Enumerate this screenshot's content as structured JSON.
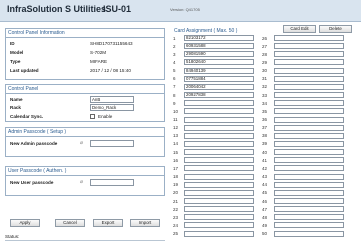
{
  "header": {
    "title": "InfraSolution S Utilities",
    "unit": "ISU-01",
    "version": "Version: Q41705"
  },
  "control_panel_info": {
    "title": "Control Panel Information",
    "id_label": "ID",
    "id_value": "SH8D170731155643",
    "model_label": "Model",
    "model_value": "S-702M",
    "type_label": "Type",
    "type_value": "MIFARE",
    "updated_label": "Last updated",
    "updated_value": "2017 / 12 / 08 15:40"
  },
  "control_panel": {
    "title": "Control Panel",
    "name_label": "Name",
    "name_value": "AnB",
    "rack_label": "Rack",
    "rack_value": "Demo_Rack",
    "sync_label": "Calendar Sync.",
    "enable_label": "Enable"
  },
  "admin_passcode": {
    "title": "Admin Passcode ( Setup )",
    "new_label": "New Admin passcode",
    "value": ""
  },
  "user_passcode": {
    "title": "User Passcode ( Authen. )",
    "new_label": "New User passcode",
    "value": ""
  },
  "bottom_buttons": {
    "apply": "Apply",
    "cancel": "Cancel",
    "export": "Export",
    "import": "Import"
  },
  "status": {
    "label": "Status:"
  },
  "cards": {
    "title": "Card Assignment ( Max. 50 )",
    "edit_label": "Card Edit",
    "delete_label": "Delete",
    "left": [
      {
        "n": "1",
        "v": "82103172"
      },
      {
        "n": "2",
        "v": "60931588"
      },
      {
        "n": "3",
        "v": "29081590"
      },
      {
        "n": "4",
        "v": "51802640"
      },
      {
        "n": "5",
        "v": "84940139"
      },
      {
        "n": "6",
        "v": "07751884"
      },
      {
        "n": "7",
        "v": "20064042"
      },
      {
        "n": "8",
        "v": "20927838"
      },
      {
        "n": "9",
        "v": ""
      },
      {
        "n": "10",
        "v": ""
      },
      {
        "n": "11",
        "v": ""
      },
      {
        "n": "12",
        "v": ""
      },
      {
        "n": "13",
        "v": ""
      },
      {
        "n": "14",
        "v": ""
      },
      {
        "n": "15",
        "v": ""
      },
      {
        "n": "16",
        "v": ""
      },
      {
        "n": "17",
        "v": ""
      },
      {
        "n": "18",
        "v": ""
      },
      {
        "n": "19",
        "v": ""
      },
      {
        "n": "20",
        "v": ""
      },
      {
        "n": "21",
        "v": ""
      },
      {
        "n": "22",
        "v": ""
      },
      {
        "n": "23",
        "v": ""
      },
      {
        "n": "24",
        "v": ""
      },
      {
        "n": "25",
        "v": ""
      }
    ],
    "right": [
      {
        "n": "26",
        "v": ""
      },
      {
        "n": "27",
        "v": ""
      },
      {
        "n": "28",
        "v": ""
      },
      {
        "n": "29",
        "v": ""
      },
      {
        "n": "30",
        "v": ""
      },
      {
        "n": "31",
        "v": ""
      },
      {
        "n": "32",
        "v": ""
      },
      {
        "n": "33",
        "v": ""
      },
      {
        "n": "34",
        "v": ""
      },
      {
        "n": "35",
        "v": ""
      },
      {
        "n": "36",
        "v": ""
      },
      {
        "n": "37",
        "v": ""
      },
      {
        "n": "38",
        "v": ""
      },
      {
        "n": "39",
        "v": ""
      },
      {
        "n": "40",
        "v": ""
      },
      {
        "n": "41",
        "v": ""
      },
      {
        "n": "42",
        "v": ""
      },
      {
        "n": "43",
        "v": ""
      },
      {
        "n": "44",
        "v": ""
      },
      {
        "n": "45",
        "v": ""
      },
      {
        "n": "46",
        "v": ""
      },
      {
        "n": "47",
        "v": ""
      },
      {
        "n": "48",
        "v": ""
      },
      {
        "n": "49",
        "v": ""
      },
      {
        "n": "50",
        "v": ""
      }
    ]
  }
}
